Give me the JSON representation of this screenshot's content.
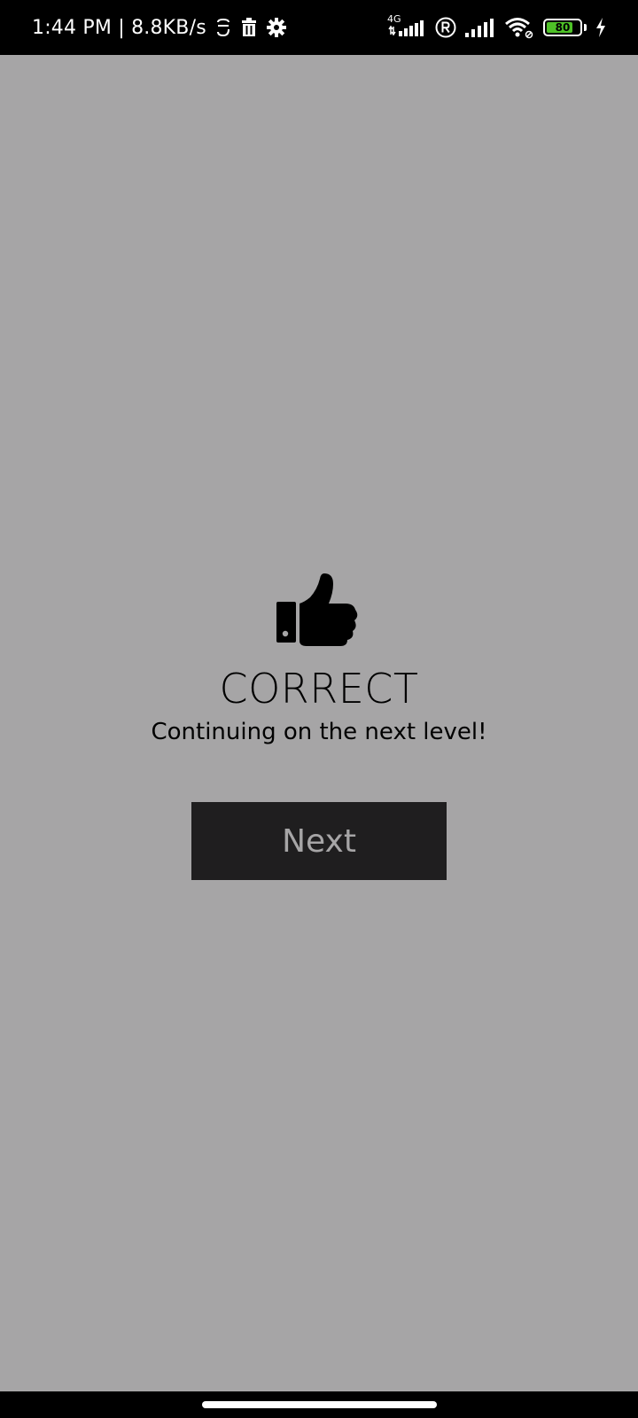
{
  "status_bar": {
    "time": "1:44 PM",
    "separator": "|",
    "speed": "8.8KB/s",
    "network_tag": "4G",
    "battery_level": "80",
    "battery_fraction": 0.8,
    "left_icons": [
      "sync-icon",
      "trash-icon",
      "gear-icon"
    ],
    "right_icons": [
      "mobile-signal-4g-icon",
      "roaming-icon",
      "mobile-signal-icon",
      "wifi-icon",
      "battery-icon",
      "charging-icon"
    ]
  },
  "result": {
    "icon": "thumbs-up-icon",
    "title": "CORRECT",
    "subtitle": "Continuing on the next level!"
  },
  "actions": {
    "next_label": "Next"
  },
  "colors": {
    "background": "#a6a5a6",
    "button_bg": "#1f1e1f",
    "button_text": "#a6a5a6",
    "battery_fill": "#4ec227"
  }
}
